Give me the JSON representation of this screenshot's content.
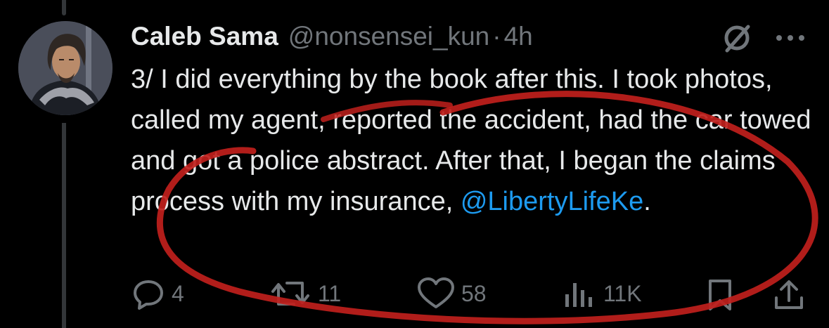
{
  "tweet": {
    "author_name": "Caleb Sama",
    "handle": "@nonsensei_kun",
    "separator": "·",
    "time": "4h",
    "text_before_mention": "3/ I did everything by the book after this. I took photos, called my agent, reported the accident, had the car towed and got a police abstract. After that, I began the claims process with my insurance, ",
    "mention": "@LibertyLifeKe",
    "text_after_mention": "."
  },
  "actions": {
    "replies": "4",
    "reposts": "11",
    "likes": "58",
    "views": "11K"
  },
  "icons": {
    "reply": "reply-icon",
    "repost": "repost-icon",
    "like": "heart-icon",
    "views": "views-icon",
    "bookmark": "bookmark-icon",
    "share": "share-icon",
    "grok": "grok-icon",
    "more": "more-icon"
  },
  "colors": {
    "background": "#000000",
    "text": "#e7e9ea",
    "muted": "#71767b",
    "link": "#1d9bf0",
    "annotation": "#c0201c"
  }
}
